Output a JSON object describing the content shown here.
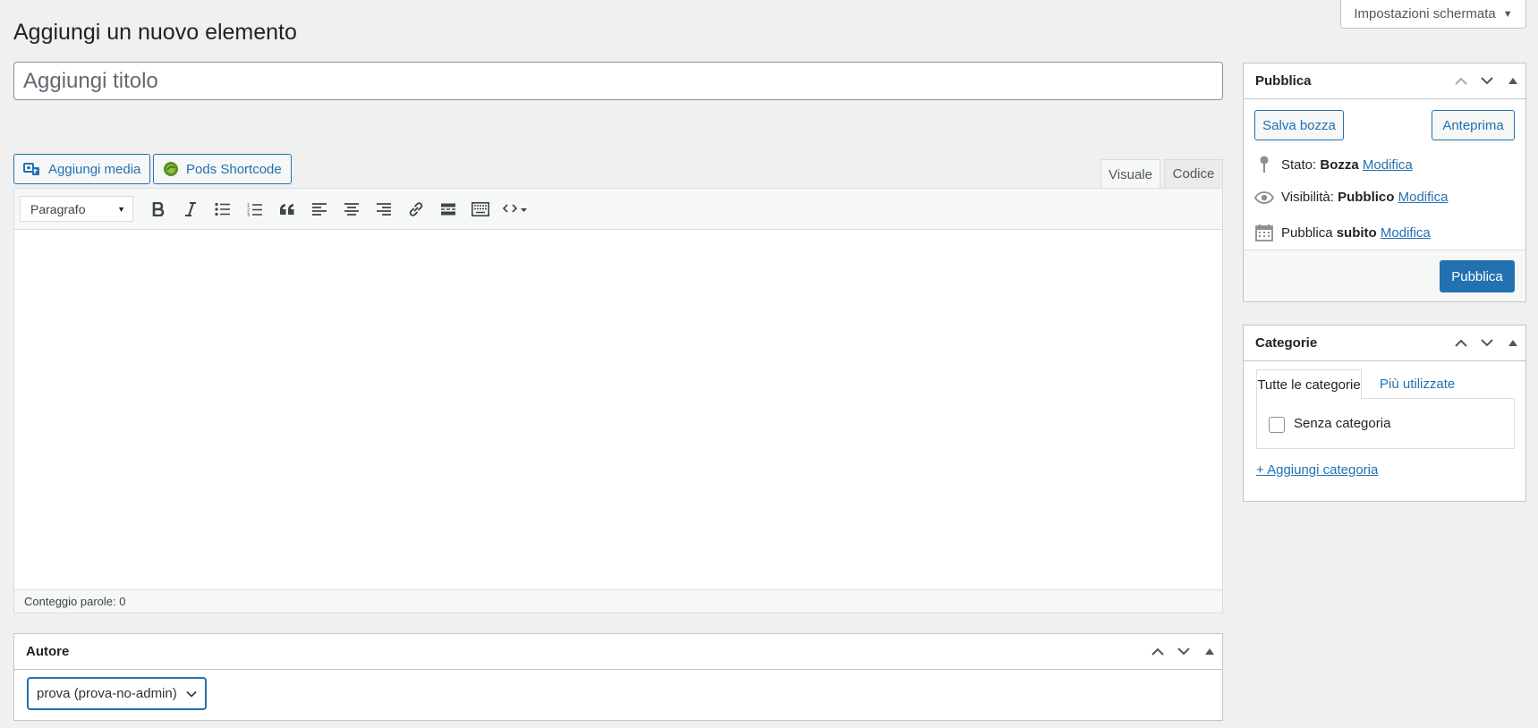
{
  "screen_options": {
    "label": "Impostazioni schermata"
  },
  "page": {
    "title": "Aggiungi un nuovo elemento"
  },
  "title_field": {
    "placeholder": "Aggiungi titolo",
    "value": ""
  },
  "media_buttons": {
    "add_media": "Aggiungi media",
    "pods_shortcode": "Pods Shortcode"
  },
  "editor": {
    "tabs": {
      "visual": "Visuale",
      "code": "Codice"
    },
    "format_select": "Paragrafo",
    "toolbar_icons": [
      "bold-icon",
      "italic-icon",
      "bulleted-list-icon",
      "numbered-list-icon",
      "blockquote-icon",
      "align-left-icon",
      "align-center-icon",
      "align-right-icon",
      "link-icon",
      "read-more-icon",
      "toolbar-toggle-icon",
      "code-icon"
    ],
    "word_count": "Conteggio parole: 0"
  },
  "author_box": {
    "title": "Autore",
    "selected": "prova (prova-no-admin)"
  },
  "publish_box": {
    "title": "Pubblica",
    "save_draft": "Salva bozza",
    "preview": "Anteprima",
    "status_label": "Stato:",
    "status_value": "Bozza",
    "visibility_label": "Visibilità:",
    "visibility_value": "Pubblico",
    "schedule_label": "Pubblica",
    "schedule_value": "subito",
    "edit_link": "Modifica",
    "publish_button": "Pubblica"
  },
  "categories_box": {
    "title": "Categorie",
    "tab_all": "Tutte le categorie",
    "tab_popular": "Più utilizzate",
    "items": [
      {
        "label": "Senza categoria",
        "checked": false
      }
    ],
    "add_link": "+ Aggiungi categoria"
  },
  "colors": {
    "accent": "#2271b1",
    "background": "#f0f0f1",
    "border": "#c3c4c7"
  }
}
